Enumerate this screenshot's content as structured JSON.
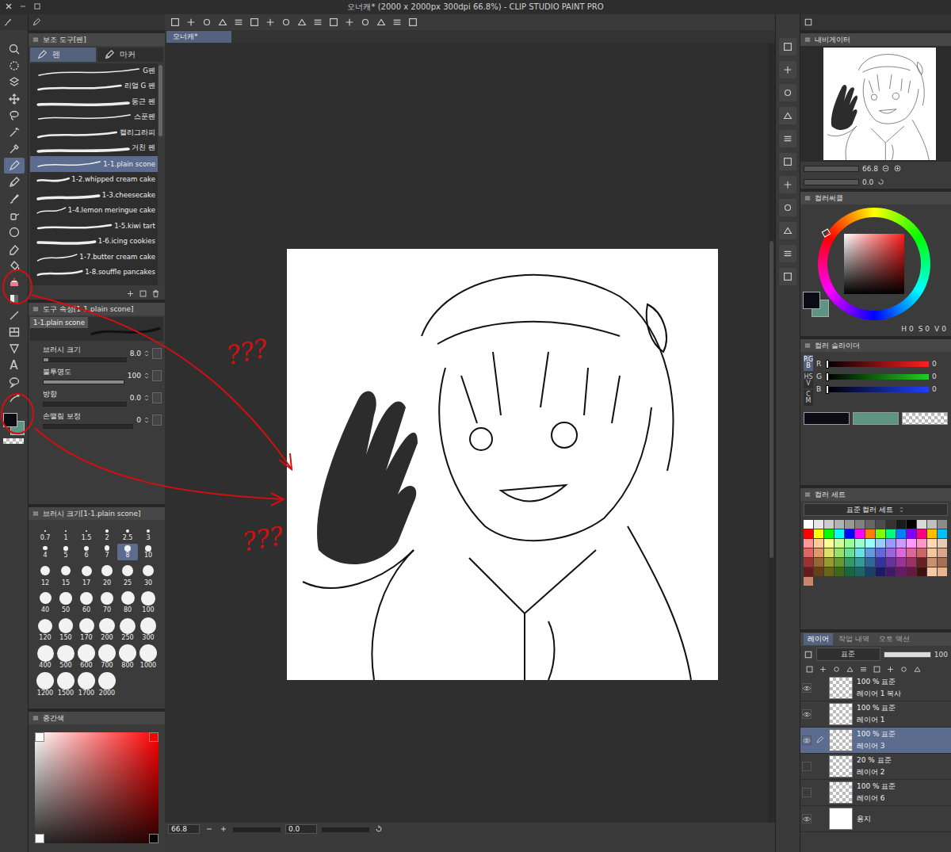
{
  "window": {
    "title": "오너캐* (2000 x 2000px 300dpi 66.8%) - CLIP STUDIO PAINT PRO"
  },
  "tools": [
    {
      "selected": false
    },
    {
      "selected": false
    },
    {
      "selected": false
    },
    {
      "selected": false
    },
    {
      "selected": false
    },
    {
      "selected": false
    },
    {
      "selected": false
    },
    {
      "selected": true
    },
    {
      "selected": false
    },
    {
      "selected": false
    },
    {
      "selected": false
    },
    {
      "selected": false
    },
    {
      "selected": false
    },
    {
      "selected": false
    },
    {
      "selected": false
    },
    {
      "selected": false
    },
    {
      "selected": false
    },
    {
      "selected": false
    },
    {
      "selected": false
    },
    {
      "selected": false,
      "glyph": "A"
    },
    {
      "selected": false
    },
    {
      "selected": false
    }
  ],
  "colors": {
    "main": "#0b0b16",
    "sub": "#5e9484"
  },
  "subtool": {
    "title": "보조 도구[펜]",
    "tabs": [
      {
        "label": "펜",
        "selected": true
      },
      {
        "label": "마커",
        "selected": false
      }
    ],
    "brushes": [
      {
        "name": "G펜",
        "selected": false
      },
      {
        "name": "리얼 G 펜",
        "selected": false
      },
      {
        "name": "둥근 펜",
        "selected": false
      },
      {
        "name": "스푼펜",
        "selected": false
      },
      {
        "name": "캘리그라피",
        "selected": false
      },
      {
        "name": "거친 펜",
        "selected": false
      },
      {
        "name": "1-1.plain scone",
        "selected": true
      },
      {
        "name": "1-2.whipped cream cake",
        "selected": false
      },
      {
        "name": "1-3.cheesecake",
        "selected": false
      },
      {
        "name": "1-4.lemon meringue cake",
        "selected": false
      },
      {
        "name": "1-5.kiwi tart",
        "selected": false
      },
      {
        "name": "1-6.icing cookies",
        "selected": false
      },
      {
        "name": "1-7.butter cream cake",
        "selected": false
      },
      {
        "name": "1-8.souffle pancakes",
        "selected": false
      }
    ]
  },
  "tool_property": {
    "title": "도구 속성[1-1.plain scone]",
    "preview": "1-1.plain scone",
    "props": [
      {
        "label": "브러시 크기",
        "value": "8.0",
        "level": 0.06
      },
      {
        "label": "불투명도",
        "value": "100",
        "level": 1
      },
      {
        "label": "방향",
        "value": "0.0",
        "level": 0
      },
      {
        "label": "손떨림 보정",
        "value": "0",
        "level": 0
      }
    ]
  },
  "brush_size": {
    "title": "브러시 크기[1-1.plain scone]",
    "sizes": [
      {
        "label": "0.7",
        "selected": false
      },
      {
        "label": "1",
        "selected": false
      },
      {
        "label": "1.5",
        "selected": false
      },
      {
        "label": "2",
        "selected": false
      },
      {
        "label": "2.5",
        "selected": false
      },
      {
        "label": "3",
        "selected": false
      },
      {
        "label": "4",
        "selected": false
      },
      {
        "label": "5",
        "selected": false
      },
      {
        "label": "6",
        "selected": false
      },
      {
        "label": "7",
        "selected": false
      },
      {
        "label": "8",
        "selected": true
      },
      {
        "label": "10",
        "selected": false
      },
      {
        "label": "12",
        "selected": false
      },
      {
        "label": "15",
        "selected": false
      },
      {
        "label": "17",
        "selected": false
      },
      {
        "label": "20",
        "selected": false
      },
      {
        "label": "25",
        "selected": false
      },
      {
        "label": "30",
        "selected": false
      },
      {
        "label": "40",
        "selected": false
      },
      {
        "label": "50",
        "selected": false
      },
      {
        "label": "60",
        "selected": false
      },
      {
        "label": "70",
        "selected": false
      },
      {
        "label": "80",
        "selected": false
      },
      {
        "label": "100",
        "selected": false
      },
      {
        "label": "120",
        "selected": false
      },
      {
        "label": "150",
        "selected": false
      },
      {
        "label": "170",
        "selected": false
      },
      {
        "label": "200",
        "selected": false
      },
      {
        "label": "250",
        "selected": false
      },
      {
        "label": "300",
        "selected": false
      },
      {
        "label": "400",
        "selected": false
      },
      {
        "label": "500",
        "selected": false
      },
      {
        "label": "600",
        "selected": false
      },
      {
        "label": "700",
        "selected": false
      },
      {
        "label": "800",
        "selected": false
      },
      {
        "label": "1000",
        "selected": false
      },
      {
        "label": "1200",
        "selected": false
      },
      {
        "label": "1500",
        "selected": false
      },
      {
        "label": "1700",
        "selected": false
      },
      {
        "label": "2000",
        "selected": false
      }
    ]
  },
  "mid_color": {
    "title": "중간색",
    "corners": [
      "#ffffff",
      "#ff0000",
      "#ffffff",
      "#000000"
    ]
  },
  "document": {
    "tab": {
      "label": "오너캐*",
      "selected": true
    }
  },
  "annotations": {
    "marks": [
      "???",
      "???"
    ]
  },
  "status": {
    "zoom": "66.8",
    "angle": "0.0"
  },
  "navigator": {
    "title": "내비게이터",
    "zoom": "66.8",
    "rotation": "0.0"
  },
  "color_circle": {
    "title": "컬러써클",
    "hue": "#ff1a1a",
    "readout": [
      {
        "label": "H",
        "value": "0"
      },
      {
        "label": "S",
        "value": "0"
      },
      {
        "label": "V",
        "value": "0"
      }
    ]
  },
  "color_slider": {
    "title": "컬러 슬라이더",
    "modes": [
      {
        "label": "RGB",
        "selected": true
      },
      {
        "label": "HSV",
        "selected": false
      },
      {
        "label": "CM",
        "selected": false
      }
    ],
    "channels": [
      {
        "label": "R",
        "value": "0",
        "level": 0,
        "color": "#ff2020"
      },
      {
        "label": "G",
        "value": "0",
        "level": 0,
        "color": "#20d020"
      },
      {
        "label": "B",
        "value": "0",
        "level": 0,
        "color": "#2040ff"
      }
    ]
  },
  "color_set": {
    "title": "컬러 세트",
    "set_name": "표준 컬러 세트",
    "swatches": [
      "#ffffff",
      "#e6e6e6",
      "#cccccc",
      "#b3b3b3",
      "#999999",
      "#808080",
      "#666666",
      "#4d4d4d",
      "#333333",
      "#1a1a1a",
      "#000000",
      "#d9d9d9",
      "#bfbfbf",
      "#8c8c8c",
      "#ff0000",
      "#ffff00",
      "#00ff00",
      "#00ffff",
      "#0000ff",
      "#ff00ff",
      "#ff8000",
      "#80ff00",
      "#00ff80",
      "#0080ff",
      "#8000ff",
      "#ff0080",
      "#ffbf00",
      "#00bfff",
      "#ff9999",
      "#ffcc99",
      "#ffff99",
      "#ccff99",
      "#99ff99",
      "#99ffcc",
      "#99ffff",
      "#99ccff",
      "#9999ff",
      "#cc99ff",
      "#ff99ff",
      "#ff99cc",
      "#ffd9b3",
      "#e6ccb3",
      "#e06666",
      "#e09966",
      "#e0e066",
      "#99e066",
      "#66e099",
      "#66e0e0",
      "#6699e0",
      "#6666e0",
      "#9966e0",
      "#e066e0",
      "#e06699",
      "#cc6666",
      "#f0c8a0",
      "#d9a88c",
      "#993333",
      "#996633",
      "#999933",
      "#669933",
      "#339966",
      "#339999",
      "#336699",
      "#333399",
      "#663399",
      "#993399",
      "#993366",
      "#662222",
      "#c89070",
      "#a87050",
      "#661a1a",
      "#664019",
      "#66661a",
      "#40661a",
      "#1a6640",
      "#1a6666",
      "#1a4066",
      "#1a1a66",
      "#401a66",
      "#661a66",
      "#661a40",
      "#401010",
      "#f3c9a8",
      "#e8b48f",
      "#c8866a"
    ]
  },
  "layers": {
    "tabs": [
      {
        "label": "레이어",
        "selected": true
      },
      {
        "label": "작업 내역",
        "selected": false
      },
      {
        "label": "오토 액션",
        "selected": false
      }
    ],
    "blend": "표준",
    "opacity": "100",
    "opacity_level": 1,
    "items": [
      {
        "name": "레이어 1 복사",
        "mode": "100 % 표준",
        "visible": true,
        "selected": false,
        "kind": "raster"
      },
      {
        "name": "레이어 1",
        "mode": "100 % 표준",
        "visible": true,
        "selected": false,
        "kind": "raster"
      },
      {
        "name": "레이어 3",
        "mode": "100 % 표준",
        "visible": true,
        "selected": true,
        "kind": "raster"
      },
      {
        "name": "레이어 2",
        "mode": "20 % 표준",
        "visible": false,
        "selected": false,
        "kind": "raster"
      },
      {
        "name": "레이어 6",
        "mode": "100 % 표준",
        "visible": false,
        "selected": false,
        "kind": "raster"
      },
      {
        "name": "용지",
        "visible": true,
        "selected": false,
        "kind": "paper"
      }
    ]
  }
}
